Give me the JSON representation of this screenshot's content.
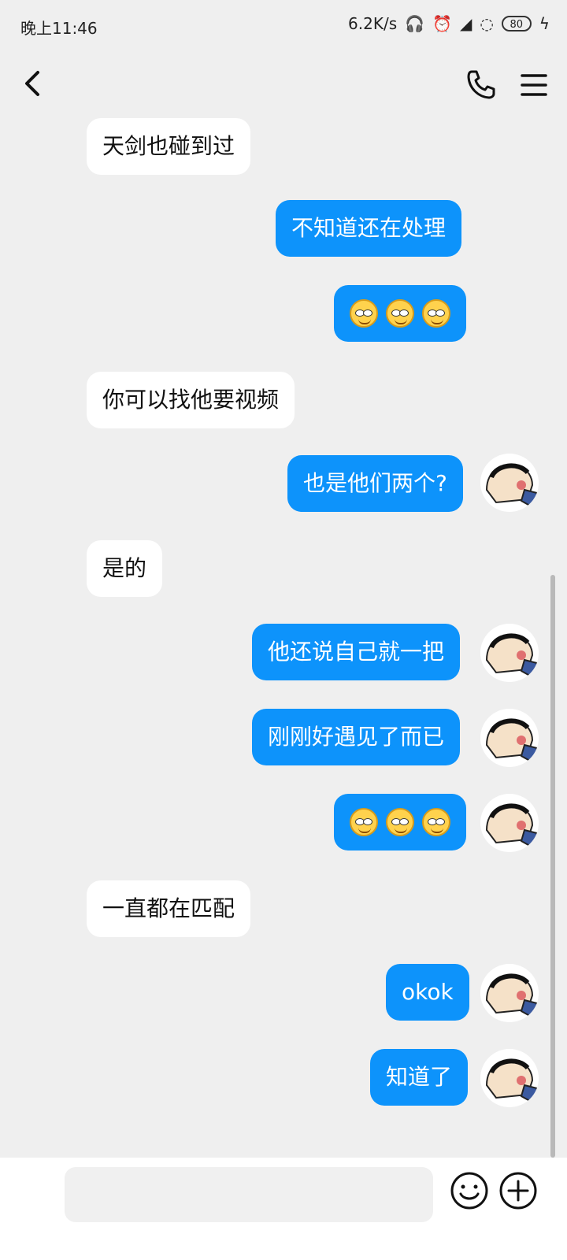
{
  "status": {
    "time": "晚上11:46",
    "net_speed": "6.2K/s",
    "battery": "80"
  },
  "messages": [
    {
      "side": "left",
      "text": "天剑也碰到过"
    },
    {
      "side": "right",
      "text": "不知道还在处理"
    },
    {
      "side": "right",
      "type": "emoji",
      "count": 3
    },
    {
      "side": "left",
      "text": "你可以找他要视频"
    },
    {
      "side": "right",
      "text": "也是他们两个?"
    },
    {
      "side": "left",
      "text": "是的"
    },
    {
      "side": "right",
      "text": "他还说自己就一把"
    },
    {
      "side": "right",
      "text": "刚刚好遇见了而已"
    },
    {
      "side": "right",
      "type": "emoji",
      "count": 3
    },
    {
      "side": "left",
      "text": "一直都在匹配"
    },
    {
      "side": "right",
      "text": "okok"
    },
    {
      "side": "right",
      "text": "知道了"
    }
  ],
  "input": {
    "value": ""
  },
  "colors": {
    "background": "#efefef",
    "bubble_right": "#0d93fb",
    "bubble_left": "#ffffff"
  }
}
